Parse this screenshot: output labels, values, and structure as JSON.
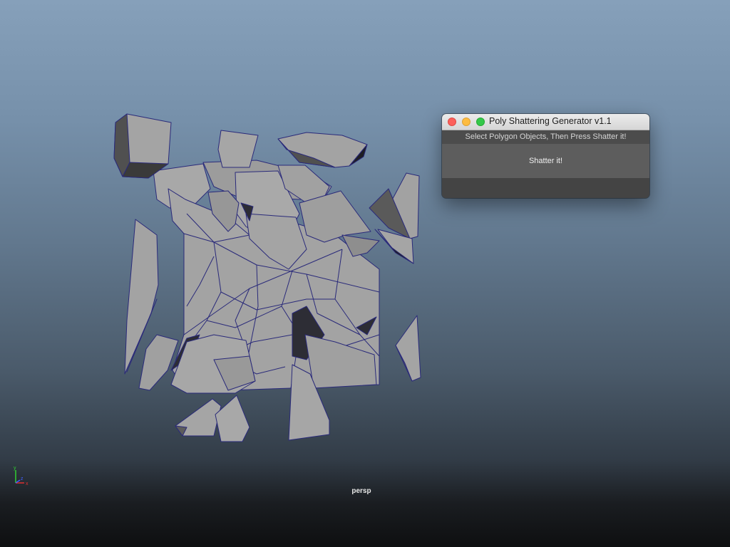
{
  "viewport": {
    "camera_label": "persp",
    "background_top": "#86a0ba",
    "background_bottom": "#0e0f10"
  },
  "scene": {
    "object": "shattered-cube",
    "fragment_color": "#a2a2a2",
    "edge_color": "#2a2a7a"
  },
  "tool_window": {
    "title": "Poly Shattering Generator v1.1",
    "instruction": "Select Polygon Objects, Then Press Shatter it!",
    "shatter_label": "Shatter it!",
    "window_controls": [
      "close-icon",
      "minimize-icon",
      "maximize-icon"
    ]
  },
  "axis_gizmo": {
    "axes": [
      "y",
      "x",
      "z"
    ],
    "colors": {
      "x": "#e03030",
      "y": "#30d030",
      "z": "#4060ff"
    }
  }
}
